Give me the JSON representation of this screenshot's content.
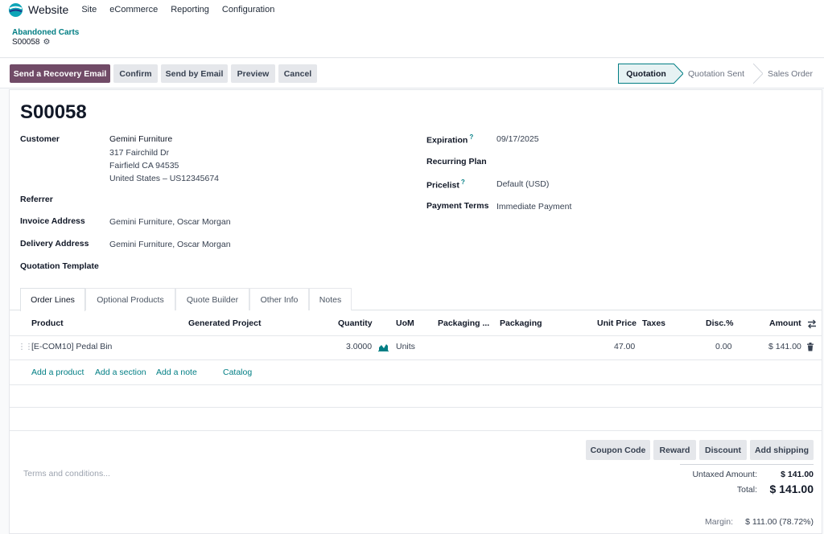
{
  "topbar": {
    "app_name": "Website",
    "menu": [
      "Site",
      "eCommerce",
      "Reporting",
      "Configuration"
    ]
  },
  "breadcrumb": {
    "parent": "Abandoned Carts",
    "record": "S00058"
  },
  "actions": {
    "recovery": "Send a Recovery Email",
    "confirm": "Confirm",
    "send_email": "Send by Email",
    "preview": "Preview",
    "cancel": "Cancel"
  },
  "statusbar": [
    "Quotation",
    "Quotation Sent",
    "Sales Order"
  ],
  "record": {
    "title": "S00058",
    "customer_label": "Customer",
    "customer_lines": [
      "Gemini Furniture",
      "317 Fairchild Dr",
      "Fairfield CA 94535",
      "United States – US12345674"
    ],
    "referrer_label": "Referrer",
    "invoice_label": "Invoice Address",
    "invoice_value": "Gemini Furniture, Oscar Morgan",
    "delivery_label": "Delivery Address",
    "delivery_value": "Gemini Furniture, Oscar Morgan",
    "template_label": "Quotation Template",
    "expiration_label": "Expiration",
    "expiration_value": "09/17/2025",
    "recurring_label": "Recurring Plan",
    "pricelist_label": "Pricelist",
    "pricelist_value": "Default (USD)",
    "payment_label": "Payment Terms",
    "payment_value": "Immediate Payment",
    "help_mark": "?"
  },
  "tabs": [
    "Order Lines",
    "Optional Products",
    "Quote Builder",
    "Other Info",
    "Notes"
  ],
  "table": {
    "headers": {
      "product": "Product",
      "project": "Generated Project",
      "quantity": "Quantity",
      "uom": "UoM",
      "packaging_qty": "Packaging ...",
      "packaging": "Packaging",
      "unit_price": "Unit Price",
      "taxes": "Taxes",
      "disc": "Disc.%",
      "amount": "Amount"
    },
    "row": {
      "product": "[E-COM10] Pedal Bin",
      "quantity": "3.0000",
      "uom": "Units",
      "unit_price": "47.00",
      "disc": "0.00",
      "amount": "$ 141.00"
    },
    "links": {
      "add_product": "Add a product",
      "add_section": "Add a section",
      "add_note": "Add a note",
      "catalog": "Catalog"
    }
  },
  "footer_buttons": {
    "coupon": "Coupon Code",
    "reward": "Reward",
    "discount": "Discount",
    "shipping": "Add shipping"
  },
  "terms_placeholder": "Terms and conditions...",
  "totals": {
    "untaxed_label": "Untaxed Amount:",
    "untaxed_value": "$ 141.00",
    "total_label": "Total:",
    "total_value": "$ 141.00",
    "margin_label": "Margin:",
    "margin_value": "$ 111.00 (78.72%)"
  },
  "colors": {
    "brand": "#714b67",
    "accent": "#017e84"
  }
}
